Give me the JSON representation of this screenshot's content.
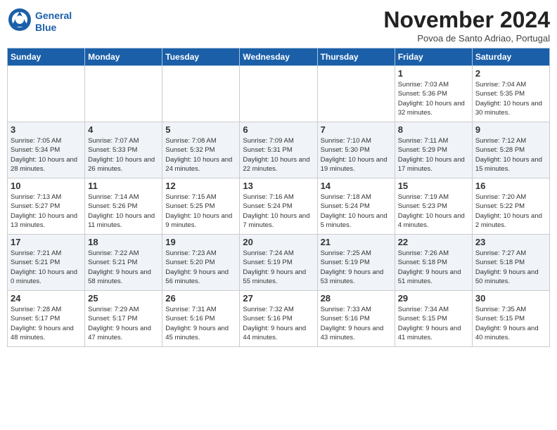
{
  "header": {
    "logo_line1": "General",
    "logo_line2": "Blue",
    "month_title": "November 2024",
    "subtitle": "Povoa de Santo Adriao, Portugal"
  },
  "weekdays": [
    "Sunday",
    "Monday",
    "Tuesday",
    "Wednesday",
    "Thursday",
    "Friday",
    "Saturday"
  ],
  "weeks": [
    [
      {
        "day": "",
        "info": ""
      },
      {
        "day": "",
        "info": ""
      },
      {
        "day": "",
        "info": ""
      },
      {
        "day": "",
        "info": ""
      },
      {
        "day": "",
        "info": ""
      },
      {
        "day": "1",
        "info": "Sunrise: 7:03 AM\nSunset: 5:36 PM\nDaylight: 10 hours\nand 32 minutes."
      },
      {
        "day": "2",
        "info": "Sunrise: 7:04 AM\nSunset: 5:35 PM\nDaylight: 10 hours\nand 30 minutes."
      }
    ],
    [
      {
        "day": "3",
        "info": "Sunrise: 7:05 AM\nSunset: 5:34 PM\nDaylight: 10 hours\nand 28 minutes."
      },
      {
        "day": "4",
        "info": "Sunrise: 7:07 AM\nSunset: 5:33 PM\nDaylight: 10 hours\nand 26 minutes."
      },
      {
        "day": "5",
        "info": "Sunrise: 7:08 AM\nSunset: 5:32 PM\nDaylight: 10 hours\nand 24 minutes."
      },
      {
        "day": "6",
        "info": "Sunrise: 7:09 AM\nSunset: 5:31 PM\nDaylight: 10 hours\nand 22 minutes."
      },
      {
        "day": "7",
        "info": "Sunrise: 7:10 AM\nSunset: 5:30 PM\nDaylight: 10 hours\nand 19 minutes."
      },
      {
        "day": "8",
        "info": "Sunrise: 7:11 AM\nSunset: 5:29 PM\nDaylight: 10 hours\nand 17 minutes."
      },
      {
        "day": "9",
        "info": "Sunrise: 7:12 AM\nSunset: 5:28 PM\nDaylight: 10 hours\nand 15 minutes."
      }
    ],
    [
      {
        "day": "10",
        "info": "Sunrise: 7:13 AM\nSunset: 5:27 PM\nDaylight: 10 hours\nand 13 minutes."
      },
      {
        "day": "11",
        "info": "Sunrise: 7:14 AM\nSunset: 5:26 PM\nDaylight: 10 hours\nand 11 minutes."
      },
      {
        "day": "12",
        "info": "Sunrise: 7:15 AM\nSunset: 5:25 PM\nDaylight: 10 hours\nand 9 minutes."
      },
      {
        "day": "13",
        "info": "Sunrise: 7:16 AM\nSunset: 5:24 PM\nDaylight: 10 hours\nand 7 minutes."
      },
      {
        "day": "14",
        "info": "Sunrise: 7:18 AM\nSunset: 5:24 PM\nDaylight: 10 hours\nand 5 minutes."
      },
      {
        "day": "15",
        "info": "Sunrise: 7:19 AM\nSunset: 5:23 PM\nDaylight: 10 hours\nand 4 minutes."
      },
      {
        "day": "16",
        "info": "Sunrise: 7:20 AM\nSunset: 5:22 PM\nDaylight: 10 hours\nand 2 minutes."
      }
    ],
    [
      {
        "day": "17",
        "info": "Sunrise: 7:21 AM\nSunset: 5:21 PM\nDaylight: 10 hours\nand 0 minutes."
      },
      {
        "day": "18",
        "info": "Sunrise: 7:22 AM\nSunset: 5:21 PM\nDaylight: 9 hours\nand 58 minutes."
      },
      {
        "day": "19",
        "info": "Sunrise: 7:23 AM\nSunset: 5:20 PM\nDaylight: 9 hours\nand 56 minutes."
      },
      {
        "day": "20",
        "info": "Sunrise: 7:24 AM\nSunset: 5:19 PM\nDaylight: 9 hours\nand 55 minutes."
      },
      {
        "day": "21",
        "info": "Sunrise: 7:25 AM\nSunset: 5:19 PM\nDaylight: 9 hours\nand 53 minutes."
      },
      {
        "day": "22",
        "info": "Sunrise: 7:26 AM\nSunset: 5:18 PM\nDaylight: 9 hours\nand 51 minutes."
      },
      {
        "day": "23",
        "info": "Sunrise: 7:27 AM\nSunset: 5:18 PM\nDaylight: 9 hours\nand 50 minutes."
      }
    ],
    [
      {
        "day": "24",
        "info": "Sunrise: 7:28 AM\nSunset: 5:17 PM\nDaylight: 9 hours\nand 48 minutes."
      },
      {
        "day": "25",
        "info": "Sunrise: 7:29 AM\nSunset: 5:17 PM\nDaylight: 9 hours\nand 47 minutes."
      },
      {
        "day": "26",
        "info": "Sunrise: 7:31 AM\nSunset: 5:16 PM\nDaylight: 9 hours\nand 45 minutes."
      },
      {
        "day": "27",
        "info": "Sunrise: 7:32 AM\nSunset: 5:16 PM\nDaylight: 9 hours\nand 44 minutes."
      },
      {
        "day": "28",
        "info": "Sunrise: 7:33 AM\nSunset: 5:16 PM\nDaylight: 9 hours\nand 43 minutes."
      },
      {
        "day": "29",
        "info": "Sunrise: 7:34 AM\nSunset: 5:15 PM\nDaylight: 9 hours\nand 41 minutes."
      },
      {
        "day": "30",
        "info": "Sunrise: 7:35 AM\nSunset: 5:15 PM\nDaylight: 9 hours\nand 40 minutes."
      }
    ]
  ]
}
